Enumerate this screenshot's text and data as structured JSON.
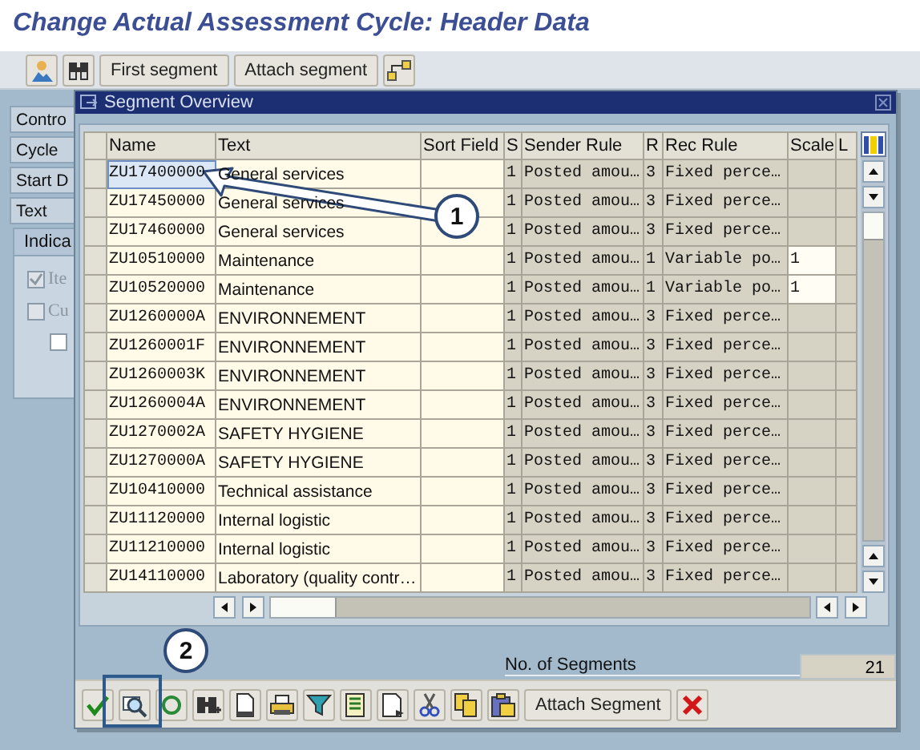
{
  "title": "Change Actual Assessment Cycle: Header Data",
  "toolbar": {
    "buttons": [
      "First segment",
      "Attach segment"
    ]
  },
  "side_tabs": [
    {
      "label": "Contro"
    },
    {
      "label": "Cycle"
    },
    {
      "label": "Start D"
    },
    {
      "label": "Text"
    }
  ],
  "indicators": {
    "title": "Indica",
    "checkboxes": [
      {
        "label": "Ite",
        "checked": true,
        "disabled": true
      },
      {
        "label": "Cu",
        "checked": false,
        "disabled": true
      },
      {
        "checked": false,
        "disabled": false
      }
    ]
  },
  "dialog": {
    "title": "Segment Overview",
    "columns": [
      "Name",
      "Text",
      "Sort Field",
      "S",
      "Sender Rule",
      "R",
      "Rec Rule",
      "Scale",
      "L"
    ],
    "rows": [
      {
        "name": "ZU17400000",
        "text": "General services",
        "s": "1",
        "sender_rule": "Posted amou…",
        "r": "3",
        "rec_rule": "Fixed perce…",
        "selected": true
      },
      {
        "name": "ZU17450000",
        "text": "General services",
        "s": "1",
        "sender_rule": "Posted amou…",
        "r": "3",
        "rec_rule": "Fixed perce…",
        "selected": false
      },
      {
        "name": "ZU17460000",
        "text": "General services",
        "s": "1",
        "sender_rule": "Posted amou…",
        "r": "3",
        "rec_rule": "Fixed perce…",
        "selected": false
      },
      {
        "name": "ZU10510000",
        "text": "Maintenance",
        "s": "1",
        "sender_rule": "Posted amou…",
        "r": "1",
        "rec_rule": "Variable po…",
        "scale": "1",
        "selected": false
      },
      {
        "name": "ZU10520000",
        "text": "Maintenance",
        "s": "1",
        "sender_rule": "Posted amou…",
        "r": "1",
        "rec_rule": "Variable po…",
        "scale": "1",
        "selected": false
      },
      {
        "name": "ZU1260000A",
        "text": "ENVIRONNEMENT",
        "s": "1",
        "sender_rule": "Posted amou…",
        "r": "3",
        "rec_rule": "Fixed perce…",
        "selected": false
      },
      {
        "name": "ZU1260001F",
        "text": "ENVIRONNEMENT",
        "s": "1",
        "sender_rule": "Posted amou…",
        "r": "3",
        "rec_rule": "Fixed perce…",
        "selected": false
      },
      {
        "name": "ZU1260003K",
        "text": "ENVIRONNEMENT",
        "s": "1",
        "sender_rule": "Posted amou…",
        "r": "3",
        "rec_rule": "Fixed perce…",
        "selected": false
      },
      {
        "name": "ZU1260004A",
        "text": "ENVIRONNEMENT",
        "s": "1",
        "sender_rule": "Posted amou…",
        "r": "3",
        "rec_rule": "Fixed perce…",
        "selected": false
      },
      {
        "name": "ZU1270002A",
        "text": "SAFETY HYGIENE",
        "s": "1",
        "sender_rule": "Posted amou…",
        "r": "3",
        "rec_rule": "Fixed perce…",
        "selected": false
      },
      {
        "name": "ZU1270000A",
        "text": "SAFETY HYGIENE",
        "s": "1",
        "sender_rule": "Posted amou…",
        "r": "3",
        "rec_rule": "Fixed perce…",
        "selected": false
      },
      {
        "name": "ZU10410000",
        "text": "Technical assistance",
        "s": "1",
        "sender_rule": "Posted amou…",
        "r": "3",
        "rec_rule": "Fixed perce…",
        "selected": false
      },
      {
        "name": "ZU11120000",
        "text": "Internal logistic",
        "s": "1",
        "sender_rule": "Posted amou…",
        "r": "3",
        "rec_rule": "Fixed perce…",
        "selected": false
      },
      {
        "name": "ZU11210000",
        "text": "Internal logistic",
        "s": "1",
        "sender_rule": "Posted amou…",
        "r": "3",
        "rec_rule": "Fixed perce…",
        "selected": false
      },
      {
        "name": "ZU14110000",
        "text": "Laboratory (quality contr…",
        "s": "1",
        "sender_rule": "Posted amou…",
        "r": "3",
        "rec_rule": "Fixed perce…",
        "selected": false
      }
    ],
    "count_label": "No. of Segments",
    "count": "21",
    "footer_button": "Attach Segment"
  },
  "callouts": [
    {
      "label": "1"
    },
    {
      "label": "2"
    }
  ]
}
